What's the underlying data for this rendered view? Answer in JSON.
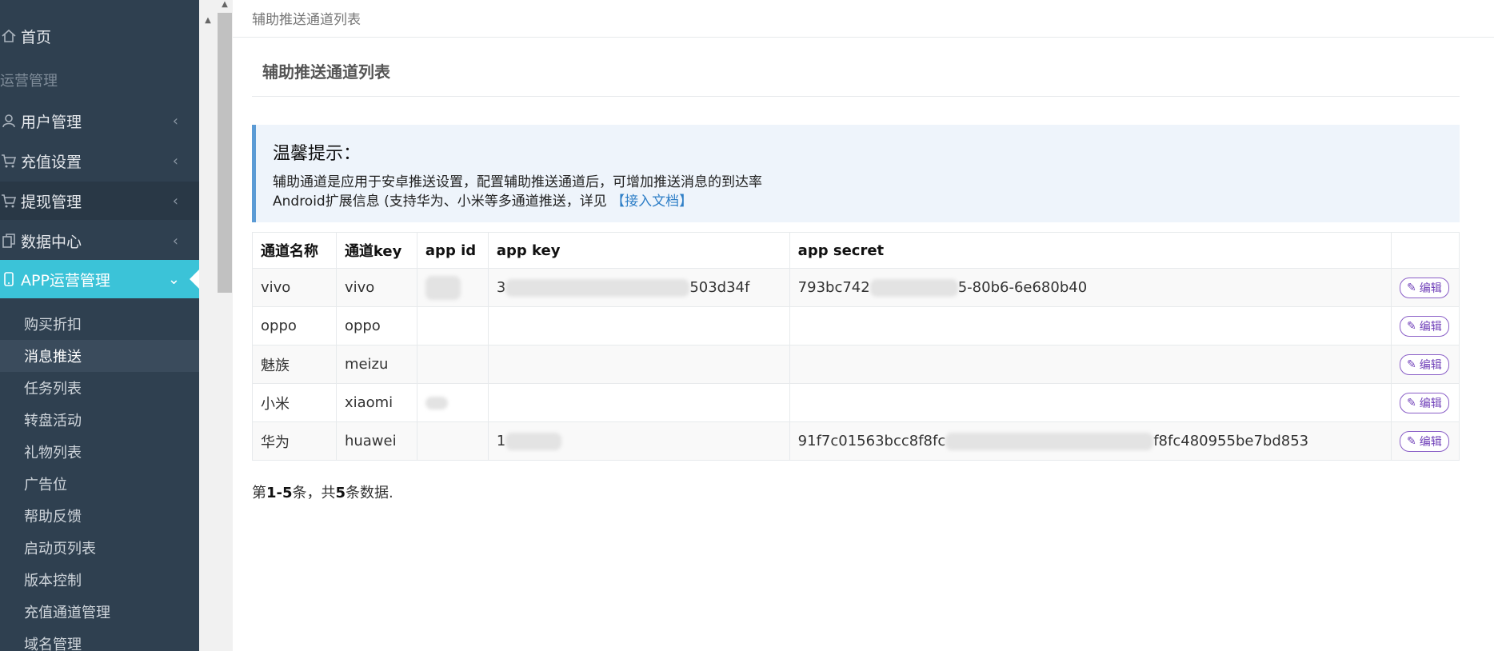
{
  "sidebar": {
    "home": "首页",
    "section_ops": "运营管理",
    "menus": [
      {
        "label": "用户管理"
      },
      {
        "label": "充值设置"
      },
      {
        "label": "提现管理"
      },
      {
        "label": "数据中心"
      },
      {
        "label": "APP运营管理"
      }
    ],
    "sub_items": [
      {
        "label": "购买折扣"
      },
      {
        "label": "消息推送"
      },
      {
        "label": "任务列表"
      },
      {
        "label": "转盘活动"
      },
      {
        "label": "礼物列表"
      },
      {
        "label": "广告位"
      },
      {
        "label": "帮助反馈"
      },
      {
        "label": "启动页列表"
      },
      {
        "label": "版本控制"
      },
      {
        "label": "充值通道管理"
      },
      {
        "label": "域名管理"
      }
    ]
  },
  "main": {
    "breadcrumb": "辅助推送通道列表",
    "title": "辅助推送通道列表",
    "tip": {
      "title": "温馨提示：",
      "line1": "辅助通道是应用于安卓推送设置，配置辅助推送通道后，可增加推送消息的到达率",
      "line2": "Android扩展信息 (支持华为、小米等多通道推送，详见",
      "link": "【接入文档】"
    },
    "table": {
      "headers": [
        "通道名称",
        "通道key",
        "app id",
        "app key",
        "app secret",
        ""
      ],
      "rows": [
        {
          "name": "vivo",
          "key": "vivo",
          "app_id": "",
          "app_key": "3",
          "app_key_tail": "503d34f",
          "app_secret": "793bc742",
          "app_secret_tail": "5-80b6-6e680b40",
          "edit": "编辑"
        },
        {
          "name": "oppo",
          "key": "oppo",
          "app_id": "",
          "app_key": "",
          "app_key_tail": "",
          "app_secret": "",
          "app_secret_tail": "",
          "edit": "编辑"
        },
        {
          "name": "魅族",
          "key": "meizu",
          "app_id": "",
          "app_key": "",
          "app_key_tail": "",
          "app_secret": "",
          "app_secret_tail": "",
          "edit": "编辑"
        },
        {
          "name": "小米",
          "key": "xiaomi",
          "app_id": "",
          "app_key": "",
          "app_key_tail": "",
          "app_secret": "",
          "app_secret_tail": "",
          "edit": "编辑"
        },
        {
          "name": "华为",
          "key": "huawei",
          "app_id": "",
          "app_key": "1",
          "app_key_tail": "",
          "app_secret": "91f7c01563bcc8f8fc",
          "app_secret_tail": "f8fc480955be7bd853",
          "edit": "编辑"
        }
      ]
    },
    "summary": {
      "pre": "第",
      "range": "1-5",
      "mid": "条，共",
      "total": "5",
      "post": "条数据."
    }
  }
}
